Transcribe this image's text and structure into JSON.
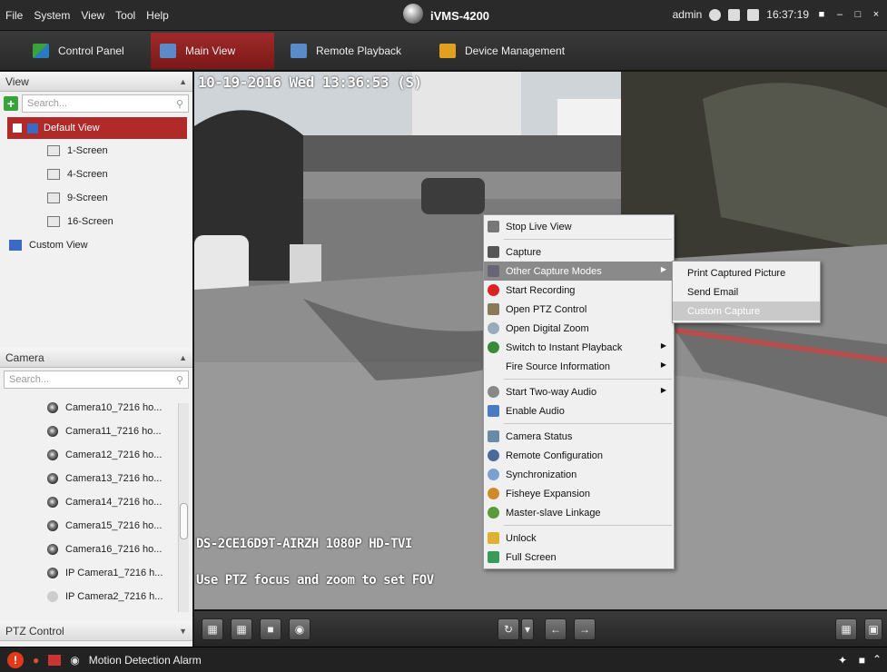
{
  "menubar": {
    "items": [
      "File",
      "System",
      "View",
      "Tool",
      "Help"
    ]
  },
  "app_title": "iVMS-4200",
  "system": {
    "user": "admin",
    "time": "16:37:19"
  },
  "tabs": [
    {
      "label": "Control Panel"
    },
    {
      "label": "Main View"
    },
    {
      "label": "Remote Playback"
    },
    {
      "label": "Device Management"
    }
  ],
  "view_panel": {
    "title": "View",
    "search_placeholder": "Search...",
    "selected": "Default View",
    "layouts": [
      "1-Screen",
      "4-Screen",
      "9-Screen",
      "16-Screen"
    ],
    "custom": "Custom View"
  },
  "camera_panel": {
    "title": "Camera",
    "search_placeholder": "Search...",
    "cameras": [
      "Camera10_7216 ho...",
      "Camera11_7216 ho...",
      "Camera12_7216 ho...",
      "Camera13_7216 ho...",
      "Camera14_7216 ho...",
      "Camera15_7216 ho...",
      "Camera16_7216 ho...",
      "IP Camera1_7216 h...",
      "IP Camera2_7216 h..."
    ]
  },
  "ptz_panel": {
    "title": "PTZ Control"
  },
  "video": {
    "timestamp": "10-19-2016 Wed 13:36:53 (S)",
    "overlay_model": "DS-2CE16D9T-AIRZH  1080P HD-TVI",
    "overlay_hint": "Use PTZ focus and zoom to set FOV"
  },
  "context_menu": {
    "stop_live_view": "Stop Live View",
    "capture": "Capture",
    "other_capture_modes": "Other Capture Modes",
    "start_recording": "Start Recording",
    "open_ptz_control": "Open PTZ Control",
    "open_digital_zoom": "Open Digital Zoom",
    "switch_instant_playback": "Switch to Instant Playback",
    "fire_source_information": "Fire Source Information",
    "start_two_way_audio": "Start Two-way Audio",
    "enable_audio": "Enable Audio",
    "camera_status": "Camera Status",
    "remote_configuration": "Remote Configuration",
    "synchronization": "Synchronization",
    "fisheye_expansion": "Fisheye Expansion",
    "master_slave_linkage": "Master-slave Linkage",
    "unlock": "Unlock",
    "full_screen": "Full Screen"
  },
  "submenu": {
    "print_captured_picture": "Print Captured Picture",
    "send_email": "Send Email",
    "custom_capture": "Custom Capture"
  },
  "statusbar": {
    "alarm_label": "Motion Detection Alarm"
  },
  "colors": {
    "accent_red": "#b02a2a",
    "menu_highlight": "#8a8a8a"
  }
}
